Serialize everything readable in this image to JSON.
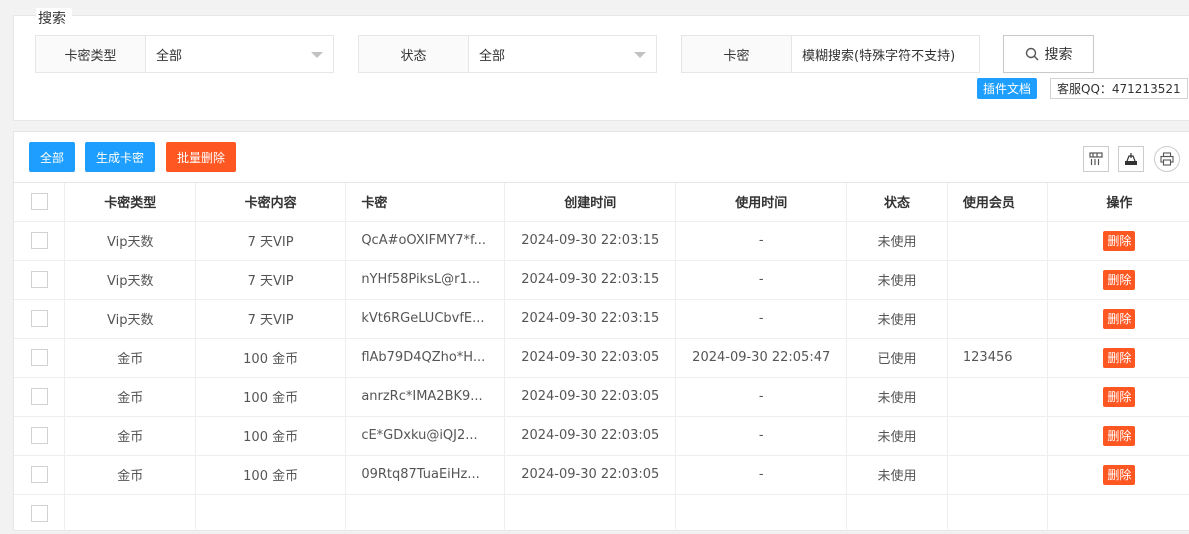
{
  "search": {
    "legend": "搜索",
    "type_label": "卡密类型",
    "type_value": "全部",
    "status_label": "状态",
    "status_value": "全部",
    "code_label": "卡密",
    "code_placeholder": "模糊搜索(特殊字符不支持)",
    "search_button": "搜索",
    "doc_badge": "插件文档",
    "qq_badge": "客服QQ：471213521"
  },
  "toolbar": {
    "all_button": "全部",
    "generate_button": "生成卡密",
    "batch_delete_button": "批量删除",
    "icons": [
      "columns-icon",
      "export-icon",
      "print-icon"
    ]
  },
  "table": {
    "headers": [
      "卡密类型",
      "卡密内容",
      "卡密",
      "创建时间",
      "使用时间",
      "状态",
      "使用会员",
      "操作"
    ],
    "rows": [
      {
        "type": "Vip天数",
        "content": "7 天VIP",
        "code": "QcA#oOXIFMY7*f...",
        "created": "2024-09-30 22:03:15",
        "used": "-",
        "status": "未使用",
        "member": "",
        "action": "删除"
      },
      {
        "type": "Vip天数",
        "content": "7 天VIP",
        "code": "nYHf58PiksL@r1...",
        "created": "2024-09-30 22:03:15",
        "used": "-",
        "status": "未使用",
        "member": "",
        "action": "删除"
      },
      {
        "type": "Vip天数",
        "content": "7 天VIP",
        "code": "kVt6RGeLUCbvfE...",
        "created": "2024-09-30 22:03:15",
        "used": "-",
        "status": "未使用",
        "member": "",
        "action": "删除"
      },
      {
        "type": "金币",
        "content": "100 金币",
        "code": "flAb79D4QZho*H...",
        "created": "2024-09-30 22:03:05",
        "used": "2024-09-30 22:05:47",
        "status": "已使用",
        "member": "123456",
        "action": "删除"
      },
      {
        "type": "金币",
        "content": "100 金币",
        "code": "anrzRc*IMA2BK9...",
        "created": "2024-09-30 22:03:05",
        "used": "-",
        "status": "未使用",
        "member": "",
        "action": "删除"
      },
      {
        "type": "金币",
        "content": "100 金币",
        "code": "cE*GDxku@iQJ2...",
        "created": "2024-09-30 22:03:05",
        "used": "-",
        "status": "未使用",
        "member": "",
        "action": "删除"
      },
      {
        "type": "金币",
        "content": "100 金币",
        "code": "09Rtq87TuaEiHz...",
        "created": "2024-09-30 22:03:05",
        "used": "-",
        "status": "未使用",
        "member": "",
        "action": "删除"
      }
    ]
  }
}
